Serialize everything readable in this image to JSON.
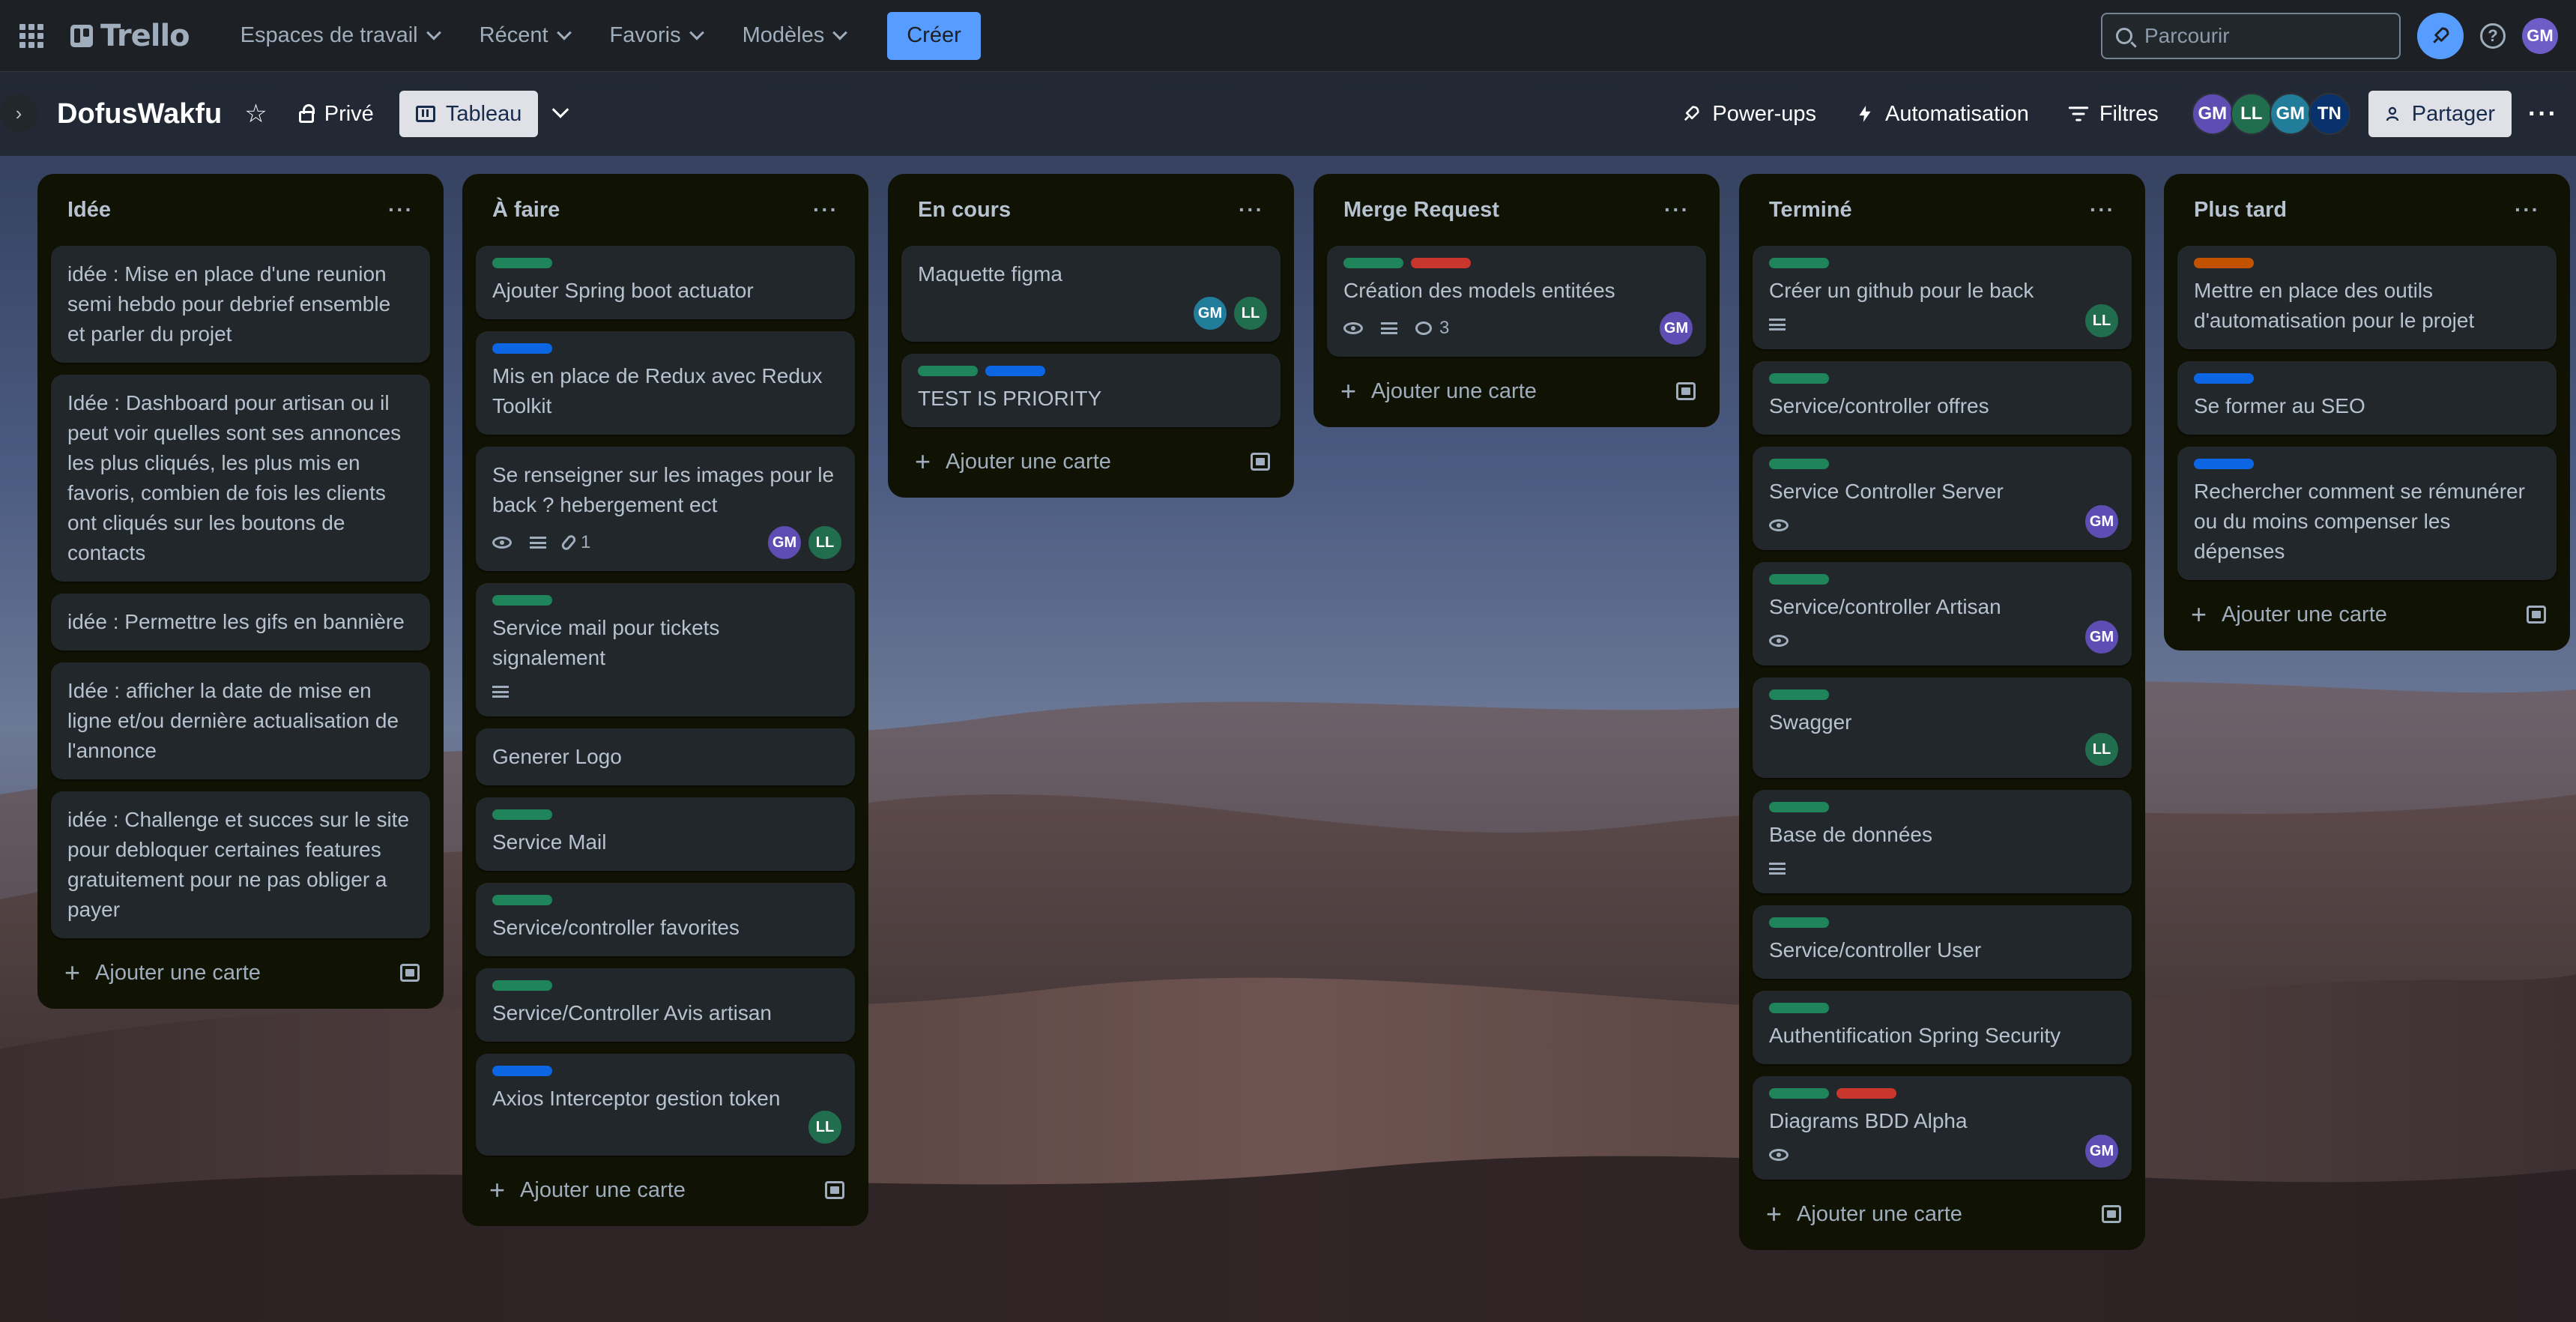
{
  "app": {
    "logo_text": "Trello"
  },
  "topnav": {
    "items": [
      {
        "label": "Espaces de travail"
      },
      {
        "label": "Récent"
      },
      {
        "label": "Favoris"
      },
      {
        "label": "Modèles"
      }
    ],
    "create_label": "Créer",
    "search_placeholder": "Parcourir",
    "user_initials": "GM"
  },
  "board": {
    "title": "DofusWakfu",
    "visibility_label": "Privé",
    "view_label": "Tableau",
    "powerups_label": "Power-ups",
    "automation_label": "Automatisation",
    "filters_label": "Filtres",
    "share_label": "Partager",
    "members": [
      "GM",
      "LL",
      "GM",
      "TN"
    ]
  },
  "colors": {
    "green_label": "#1f845a",
    "blue_label": "#0c66e4",
    "red_label": "#c9372c",
    "orange_label": "#c25100",
    "create_button": "#579dff"
  },
  "add_card_label": "Ajouter une carte",
  "lists": [
    {
      "title": "Idée",
      "cards": [
        {
          "text": "idée : Mise en place d'une reunion semi hebdo pour debrief ensemble et parler du projet"
        },
        {
          "text": "Idée : Dashboard pour artisan ou il peut voir quelles sont ses annonces les plus cliqués, les plus mis en favoris, combien de fois les clients ont cliqués sur les boutons de contacts"
        },
        {
          "text": "idée : Permettre les gifs en bannière"
        },
        {
          "text": "Idée : afficher la date de mise en ligne et/ou dernière actualisation de l'annonce"
        },
        {
          "text": "idée : Challenge et succes sur le site pour debloquer certaines features gratuitement pour ne pas obliger a payer"
        }
      ]
    },
    {
      "title": "À faire",
      "cards": [
        {
          "text": "Ajouter Spring boot actuator",
          "labels": [
            "green"
          ]
        },
        {
          "text": "Mis en place de Redux avec Redux Toolkit",
          "labels": [
            "blue"
          ]
        },
        {
          "text": "Se renseigner sur les images pour le back ? hebergement ect",
          "badges": {
            "watch": true,
            "description": true,
            "attachments": "1"
          },
          "members": [
            "GM",
            "LL"
          ]
        },
        {
          "text": "Service mail pour tickets signalement",
          "labels": [
            "green"
          ],
          "badges": {
            "description": true
          }
        },
        {
          "text": "Generer Logo"
        },
        {
          "text": "Service Mail",
          "labels": [
            "green"
          ]
        },
        {
          "text": "Service/controller favorites",
          "labels": [
            "green"
          ]
        },
        {
          "text": "Service/Controller Avis artisan",
          "labels": [
            "green"
          ]
        },
        {
          "text": "Axios Interceptor gestion token",
          "labels": [
            "blue"
          ],
          "members": [
            "LL"
          ]
        }
      ]
    },
    {
      "title": "En cours",
      "cards": [
        {
          "text": "Maquette figma",
          "members": [
            "GM",
            "LL"
          ]
        },
        {
          "text": "TEST IS PRIORITY",
          "labels": [
            "green",
            "blue"
          ]
        }
      ]
    },
    {
      "title": "Merge Request",
      "cards": [
        {
          "text": "Création des models entitées",
          "labels": [
            "green",
            "red"
          ],
          "badges": {
            "watch": true,
            "description": true,
            "comments": "3"
          },
          "members": [
            "GM"
          ]
        }
      ]
    },
    {
      "title": "Terminé",
      "cards": [
        {
          "text": "Créer un github pour le back",
          "labels": [
            "green"
          ],
          "badges": {
            "description": true
          },
          "members": [
            "LL"
          ]
        },
        {
          "text": "Service/controller offres",
          "labels": [
            "green"
          ]
        },
        {
          "text": "Service Controller Server",
          "labels": [
            "green"
          ],
          "badges": {
            "watch": true
          },
          "members": [
            "GM"
          ]
        },
        {
          "text": "Service/controller Artisan",
          "labels": [
            "green"
          ],
          "badges": {
            "watch": true
          },
          "members": [
            "GM"
          ]
        },
        {
          "text": "Swagger",
          "labels": [
            "green"
          ],
          "members": [
            "LL"
          ]
        },
        {
          "text": "Base de données",
          "labels": [
            "green"
          ],
          "badges": {
            "description": true
          }
        },
        {
          "text": "Service/controller User",
          "labels": [
            "green"
          ]
        },
        {
          "text": "Authentification Spring Security",
          "labels": [
            "green"
          ]
        },
        {
          "text": "Diagrams BDD Alpha",
          "labels": [
            "green",
            "red"
          ],
          "badges": {
            "watch": true
          },
          "members": [
            "GM"
          ]
        }
      ]
    },
    {
      "title": "Plus tard",
      "cards": [
        {
          "text": "Mettre en place des outils d'automatisation pour le projet",
          "labels": [
            "orange"
          ]
        },
        {
          "text": "Se former au SEO",
          "labels": [
            "blue"
          ]
        },
        {
          "text": "Rechercher comment se rémunérer ou du moins compenser les dépenses",
          "labels": [
            "blue"
          ]
        }
      ]
    }
  ]
}
